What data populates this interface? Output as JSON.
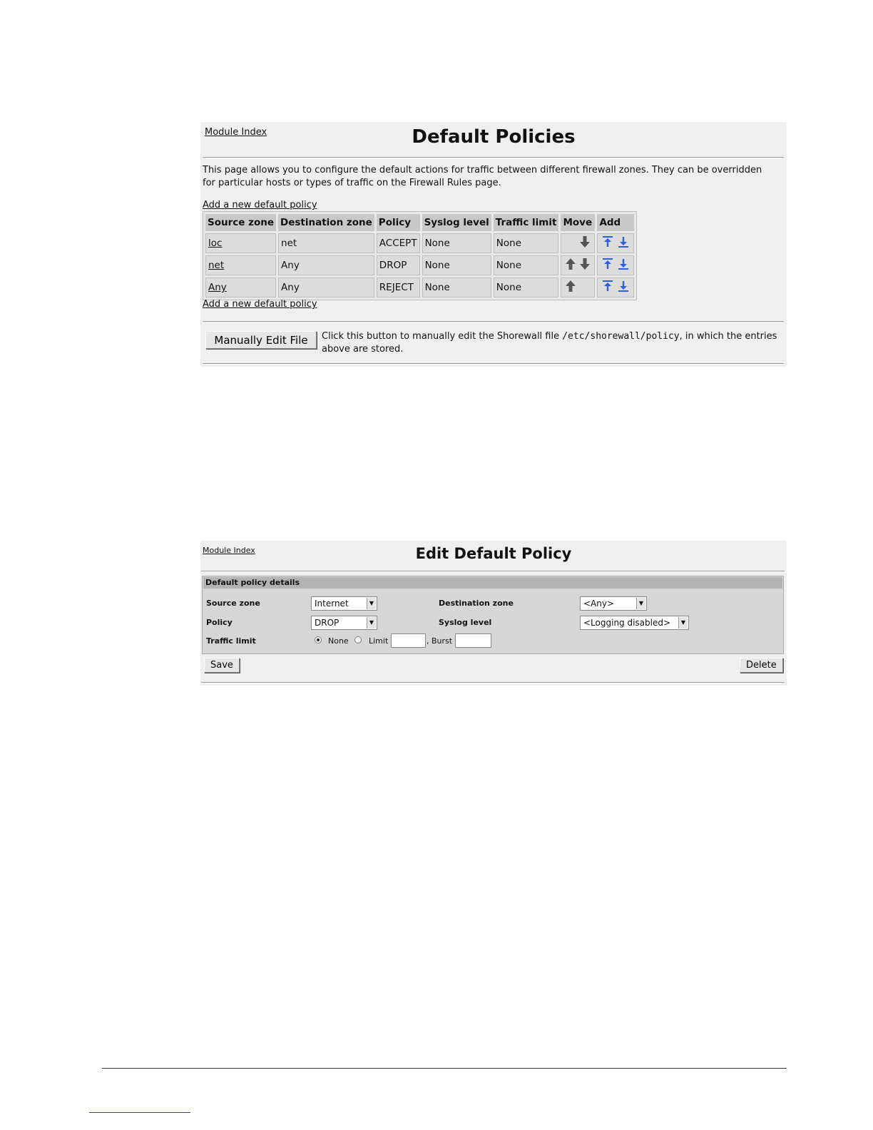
{
  "panel1": {
    "module_index": "Module Index",
    "title": "Default Policies",
    "description": "This page allows you to configure the default actions for traffic between different firewall zones. They can be overridden for particular hosts or types of traffic on the Firewall Rules page.",
    "add_link_top": "Add a new default policy",
    "add_link_bottom": "Add a new default policy",
    "columns": [
      "Source zone",
      "Destination zone",
      "Policy",
      "Syslog level",
      "Traffic limit",
      "Move",
      "Add"
    ],
    "rows": [
      {
        "source": "loc",
        "destination": "net",
        "policy": "ACCEPT",
        "syslog": "None",
        "limit": "None",
        "move_up": false,
        "move_down": true
      },
      {
        "source": "net",
        "destination": "Any",
        "policy": "DROP",
        "syslog": "None",
        "limit": "None",
        "move_up": true,
        "move_down": true
      },
      {
        "source": "Any",
        "destination": "Any",
        "policy": "REJECT",
        "syslog": "None",
        "limit": "None",
        "move_up": true,
        "move_down": false
      }
    ],
    "icons": {
      "move_up": "up-arrow-icon",
      "move_down": "down-arrow-icon",
      "add_above": "add-above-icon",
      "add_below": "add-below-icon"
    },
    "colors": {
      "move_arrow": "#555555",
      "add_arrow": "#2f5fe0"
    },
    "edit_button": "Manually Edit File",
    "edit_desc_pre": "Click this button to manually edit the Shorewall file ",
    "edit_desc_path": "/etc/shorewall/policy",
    "edit_desc_post": ", in which the entries above are stored."
  },
  "panel2": {
    "module_index": "Module Index",
    "title": "Edit Default Policy",
    "section_title": "Default policy details",
    "source_zone_label": "Source zone",
    "source_zone_value": "Internet",
    "destination_zone_label": "Destination zone",
    "destination_zone_value": "<Any>",
    "policy_label": "Policy",
    "policy_value": "DROP",
    "syslog_label": "Syslog level",
    "syslog_value": "<Logging disabled>",
    "traffic_limit_label": "Traffic limit",
    "radio_none": "None",
    "radio_limit": "Limit",
    "burst_label": ", Burst",
    "limit_value": "",
    "burst_value": "",
    "selected_radio": "None",
    "save_button": "Save",
    "delete_button": "Delete"
  }
}
